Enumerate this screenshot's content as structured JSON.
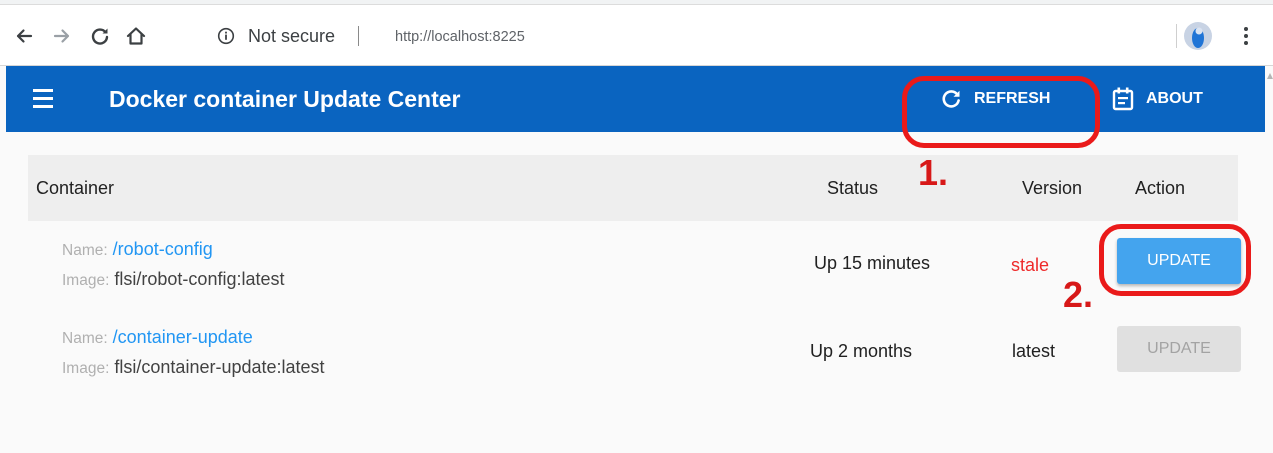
{
  "browser": {
    "security_label": "Not secure",
    "url": "http://localhost:8225"
  },
  "toolbar": {
    "title": "Docker container Update Center",
    "refresh_label": "REFRESH",
    "about_label": "ABOUT"
  },
  "table": {
    "columns": [
      "Container",
      "Status",
      "Version",
      "Action"
    ],
    "name_key": "Name:",
    "image_key": "Image:",
    "rows": [
      {
        "name": "/robot-config",
        "image": "flsi/robot-config:latest",
        "status": "Up 15 minutes",
        "version": "stale",
        "action": "UPDATE"
      },
      {
        "name": "/container-update",
        "image": "flsi/container-update:latest",
        "status": "Up 2 months",
        "version": "latest",
        "action": "UPDATE"
      }
    ]
  },
  "annotations": {
    "step1": "1.",
    "step2": "2."
  },
  "colors": {
    "toolbar": "#0a64c0",
    "link": "#2196f3",
    "stale": "#ee2a2a",
    "primary_button": "#44a4ee",
    "annotation": "#ea1a1a"
  }
}
